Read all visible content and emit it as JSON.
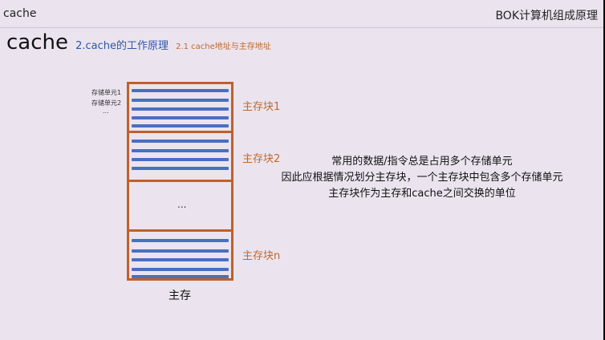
{
  "header": {
    "left_title": "cache",
    "right_title": "BOK计算机组成原理"
  },
  "heading": {
    "main": "cache",
    "sub": "2.cache的工作原理",
    "subsub": "2.1 cache地址与主存地址"
  },
  "diagram": {
    "unit_labels": [
      "存储单元1",
      "存储单元2",
      "..."
    ],
    "blocks": [
      "主存块1",
      "主存块2",
      "主存块n"
    ],
    "middle_dots": "...",
    "memory_label": "主存"
  },
  "description": {
    "lines": [
      "常用的数据/指令总是占用多个存储单元",
      "因此应根据情况划分主存块，一个主存块中包含多个存储单元",
      "主存块作为主存和cache之间交换的单位"
    ]
  },
  "colors": {
    "block_border": "#c0602a",
    "stripe": "#4a6fc0",
    "block_label": "#c0682a",
    "subtitle": "#2f57a3"
  }
}
